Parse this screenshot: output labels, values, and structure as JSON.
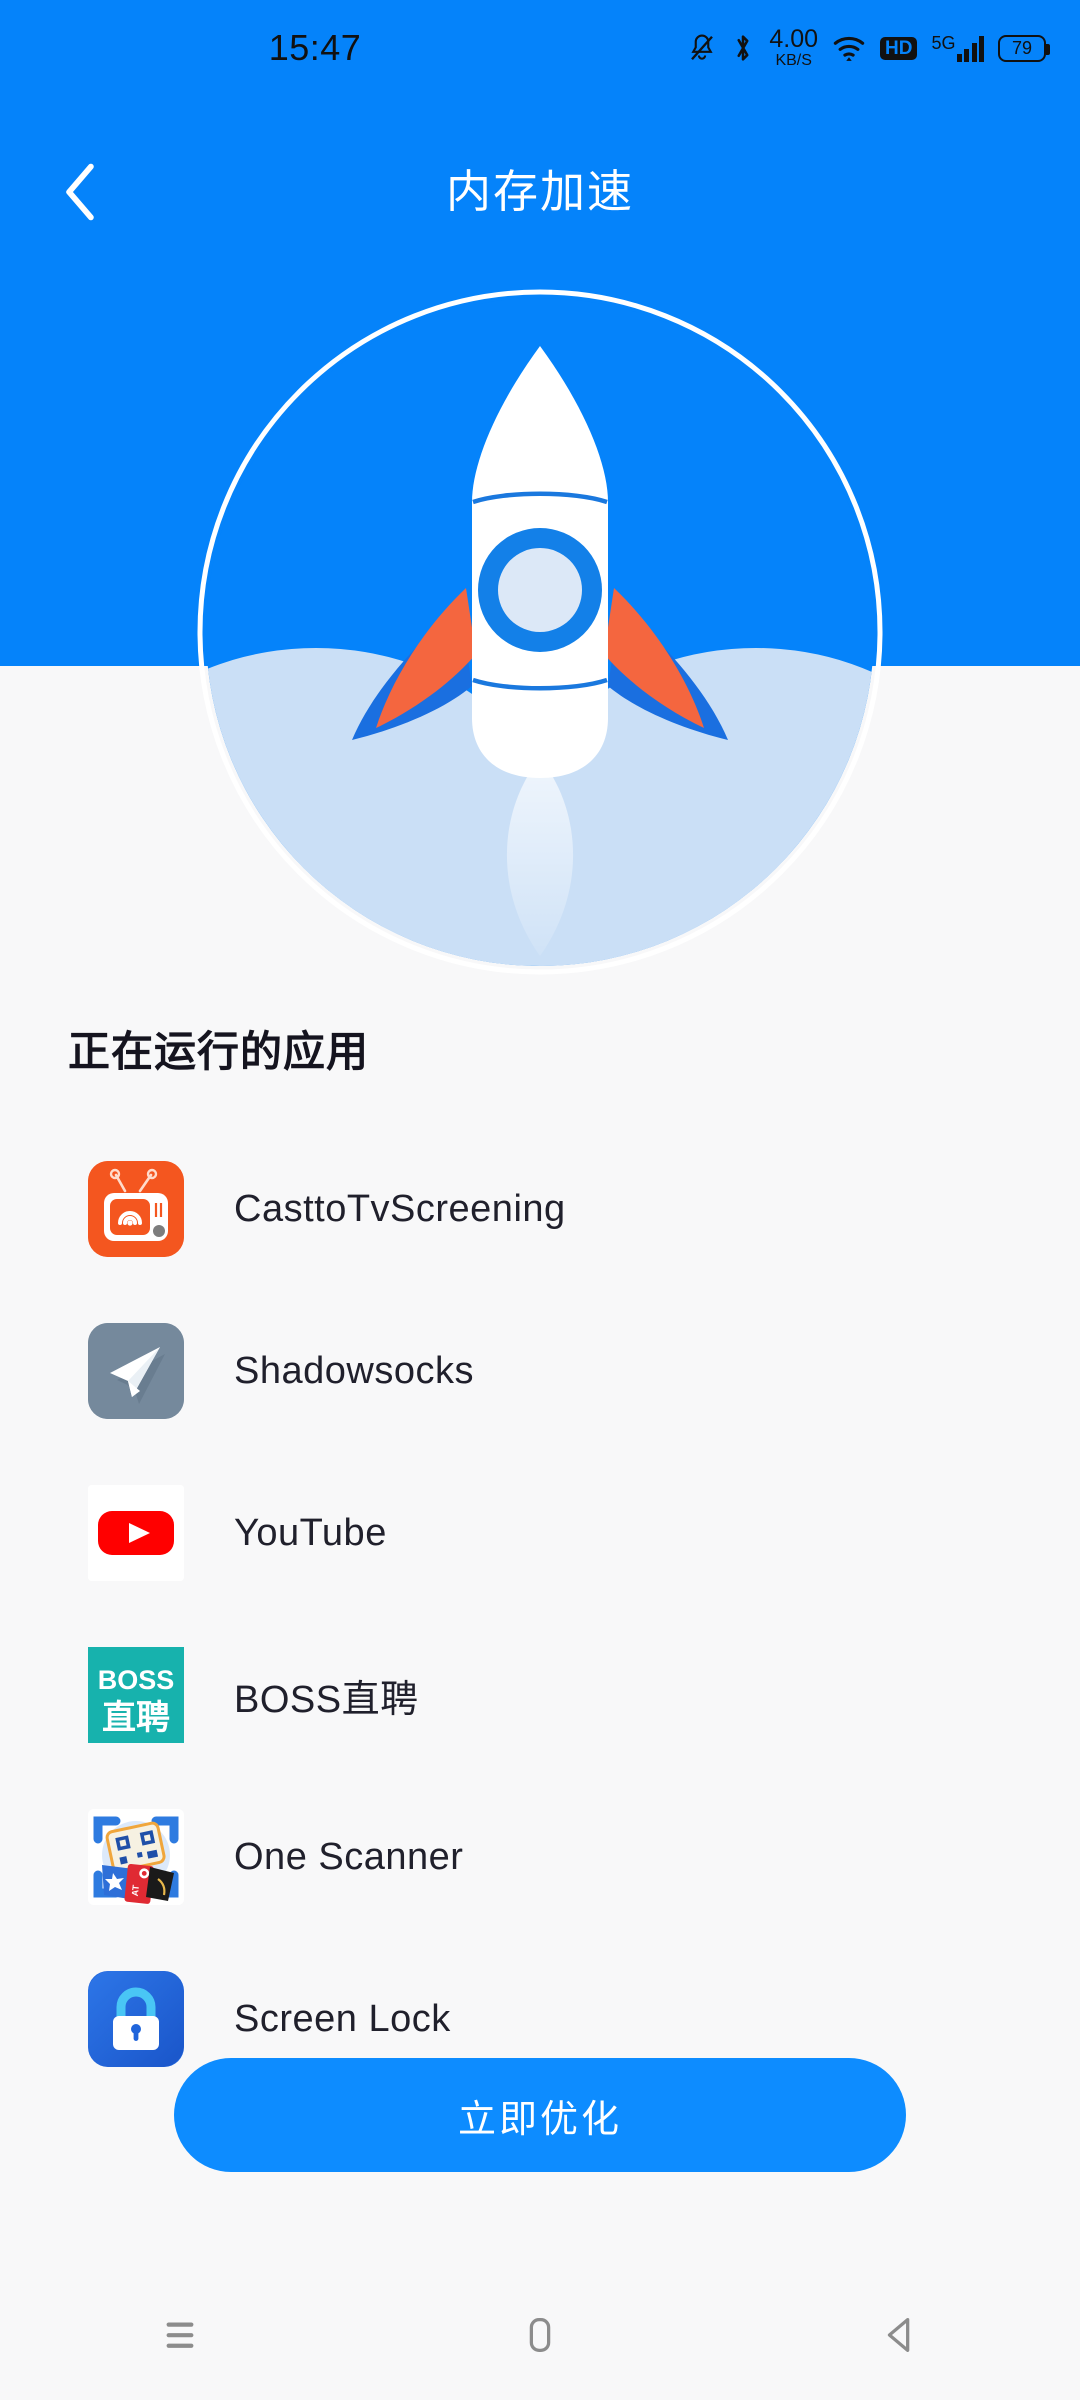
{
  "status_bar": {
    "time": "15:47",
    "network_speed_value": "4.00",
    "network_speed_unit": "KB/S",
    "hd_label": "HD",
    "network_type": "5G",
    "battery_percent": "79",
    "icons": [
      "mute-icon",
      "bluetooth-icon",
      "network-speed",
      "wifi-icon",
      "hd-icon",
      "signal-icon",
      "battery-icon"
    ]
  },
  "header": {
    "title": "内存加速",
    "back_icon": "chevron-left-icon",
    "background_color": "#0583FA"
  },
  "hero": {
    "illustration": "rocket-illustration",
    "ring_color": "#FFFFFF",
    "disc_color": "#0583FA",
    "cloud_color": "#CADFF6",
    "fin_color": "#F4663F",
    "fin_shadow_color": "#1A6FE0",
    "window_ring_color": "#1380E8",
    "window_fill_color": "#DCE8F7"
  },
  "main": {
    "section_title": "正在运行的应用",
    "apps": [
      {
        "name": "CasttoTvScreening",
        "icon": "cast-tv-icon",
        "color": "#F4561F"
      },
      {
        "name": "Shadowsocks",
        "icon": "paper-plane-icon",
        "color": "#75899C"
      },
      {
        "name": "YouTube",
        "icon": "youtube-icon",
        "color": "#FFFFFF"
      },
      {
        "name": "BOSS直聘",
        "icon": "boss-zhipin-icon",
        "color": "#17B2AD"
      },
      {
        "name": "One Scanner",
        "icon": "qr-scanner-icon",
        "color": "#2E7BE0"
      },
      {
        "name": "Screen Lock",
        "icon": "padlock-icon",
        "color": "#2065DB"
      }
    ]
  },
  "cta": {
    "label": "立即优化",
    "color": "#0D8CFF"
  },
  "nav_bar": {
    "recents_label": "recents-icon",
    "home_label": "home-icon",
    "back_label": "back-icon"
  }
}
